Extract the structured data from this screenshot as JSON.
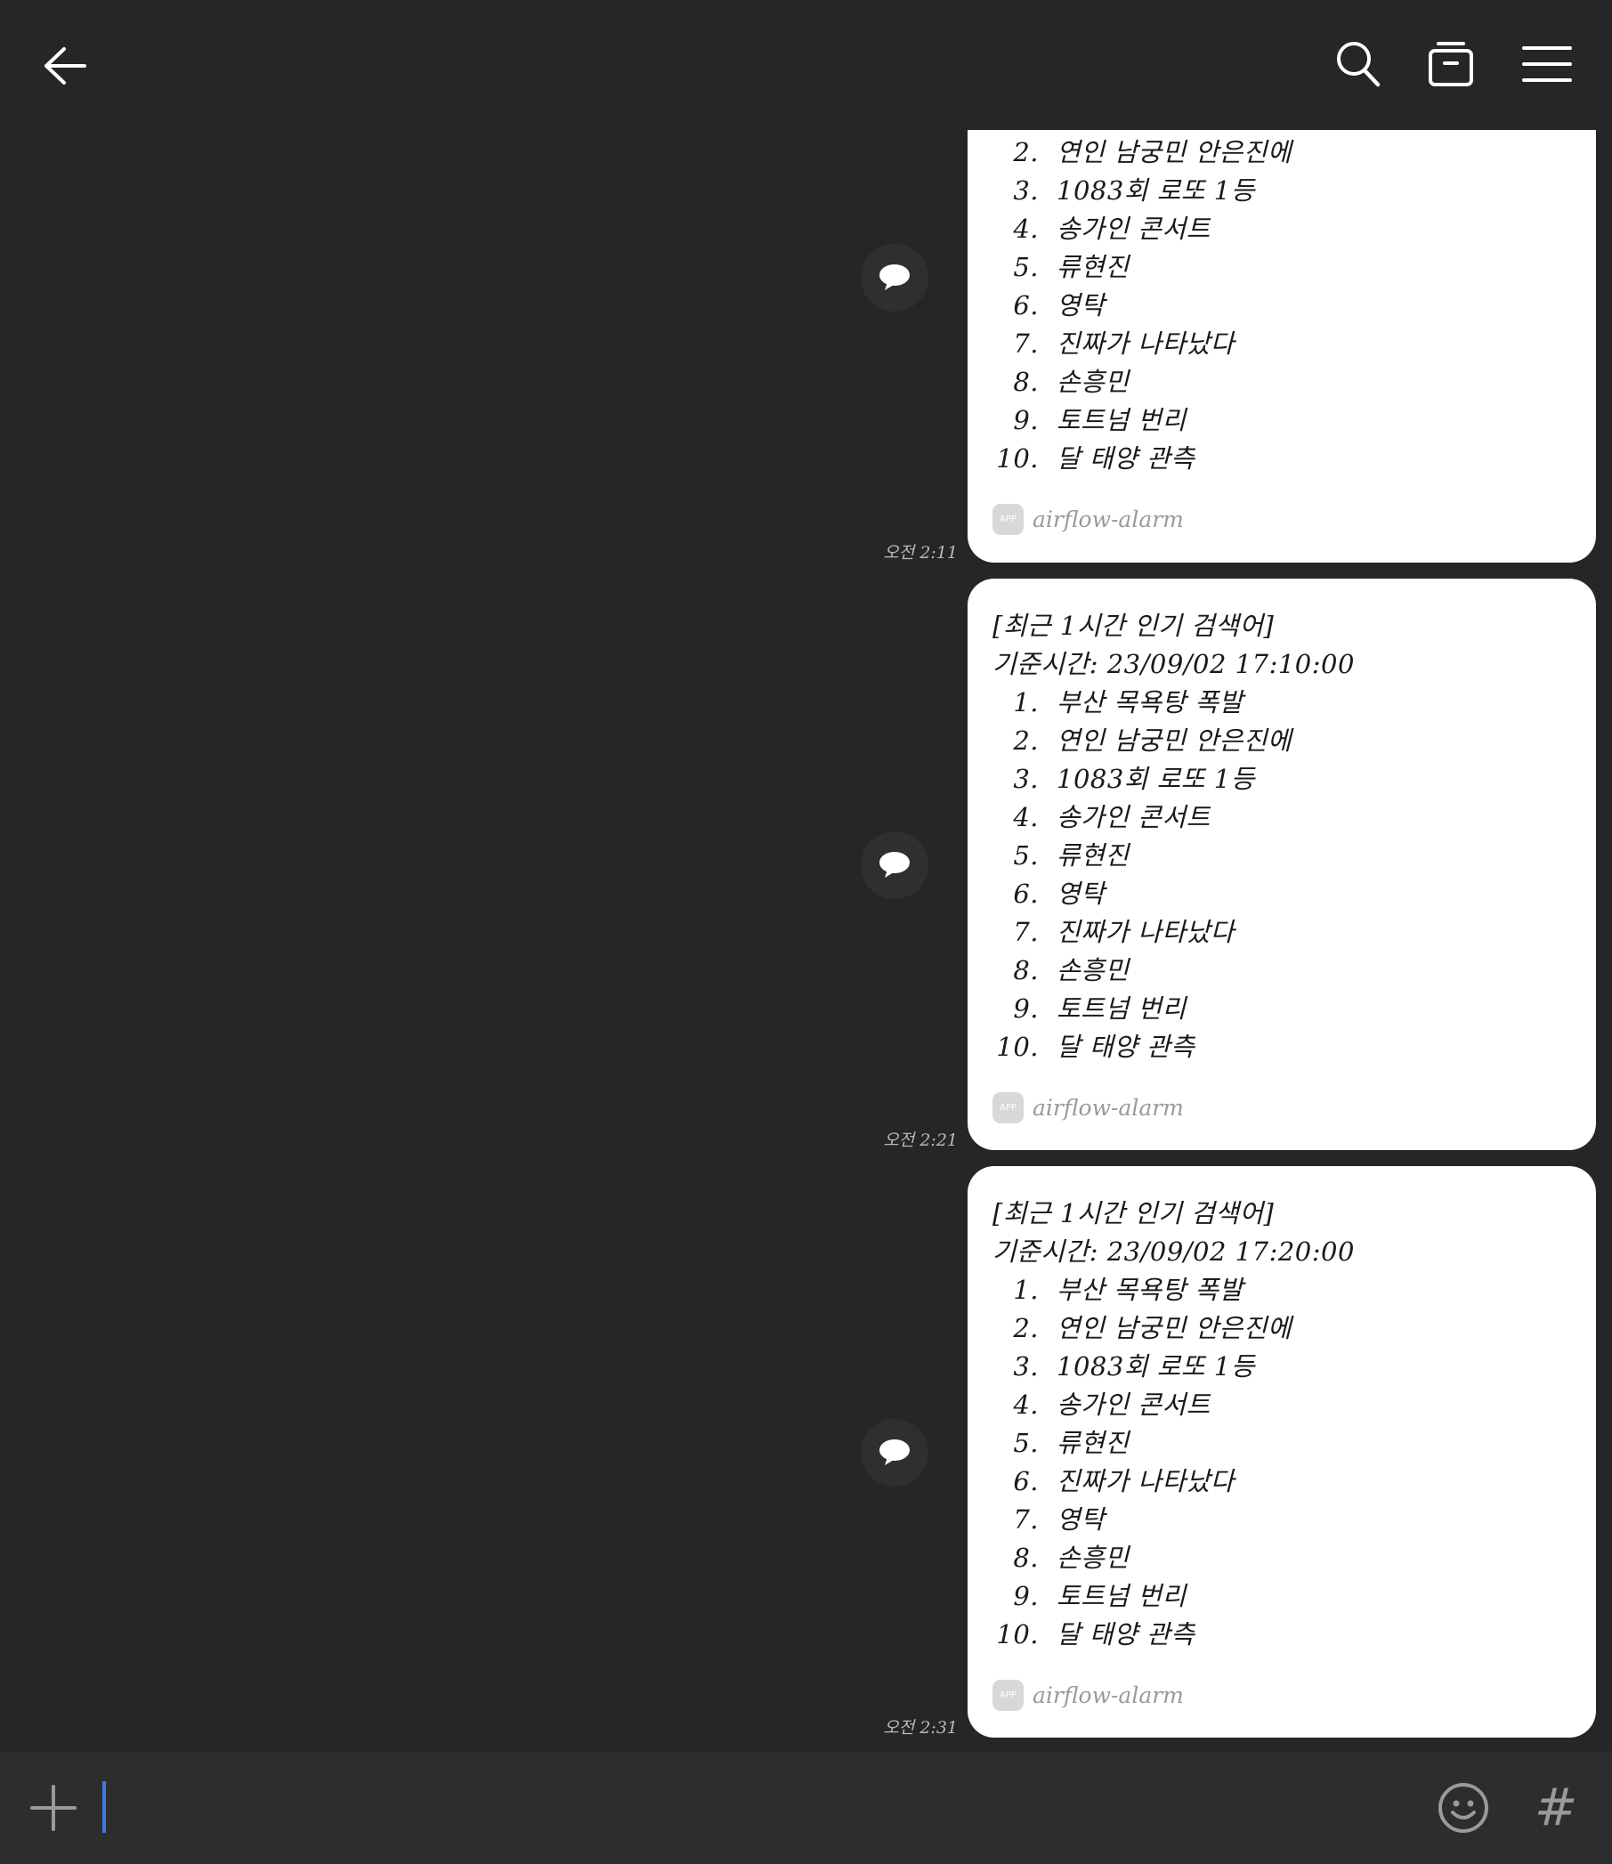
{
  "topbar": {
    "back_icon": "arrow-left-icon",
    "search_icon": "search-icon",
    "drawer_icon": "archive-box-icon",
    "menu_icon": "hamburger-menu-icon"
  },
  "messages": [
    {
      "header_lines": [],
      "items": [
        {
          "num": "2.",
          "text": "연인 남궁민 안은진에"
        },
        {
          "num": "3.",
          "text": "1083회 로또 1등"
        },
        {
          "num": "4.",
          "text": "송가인 콘서트"
        },
        {
          "num": "5.",
          "text": "류현진"
        },
        {
          "num": "6.",
          "text": "영탁"
        },
        {
          "num": "7.",
          "text": "진짜가 나타났다"
        },
        {
          "num": "8.",
          "text": "손흥민"
        },
        {
          "num": "9.",
          "text": "토트넘 번리"
        },
        {
          "num": "10.",
          "text": "달 태양 관측"
        }
      ],
      "app_badge": "APP",
      "app_name": "airflow-alarm",
      "time": "오전 2:11"
    },
    {
      "header_lines": [
        "[최근 1시간 인기 검색어]",
        "기준시간: 23/09/02 17:10:00"
      ],
      "items": [
        {
          "num": "1.",
          "text": "부산 목욕탕 폭발"
        },
        {
          "num": "2.",
          "text": "연인 남궁민 안은진에"
        },
        {
          "num": "3.",
          "text": "1083회 로또 1등"
        },
        {
          "num": "4.",
          "text": "송가인 콘서트"
        },
        {
          "num": "5.",
          "text": "류현진"
        },
        {
          "num": "6.",
          "text": "영탁"
        },
        {
          "num": "7.",
          "text": "진짜가 나타났다"
        },
        {
          "num": "8.",
          "text": "손흥민"
        },
        {
          "num": "9.",
          "text": "토트넘 번리"
        },
        {
          "num": "10.",
          "text": "달 태양 관측"
        }
      ],
      "app_badge": "APP",
      "app_name": "airflow-alarm",
      "time": "오전 2:21"
    },
    {
      "header_lines": [
        "[최근 1시간 인기 검색어]",
        "기준시간: 23/09/02 17:20:00"
      ],
      "items": [
        {
          "num": "1.",
          "text": "부산 목욕탕 폭발"
        },
        {
          "num": "2.",
          "text": "연인 남궁민 안은진에"
        },
        {
          "num": "3.",
          "text": "1083회 로또 1등"
        },
        {
          "num": "4.",
          "text": "송가인 콘서트"
        },
        {
          "num": "5.",
          "text": "류현진"
        },
        {
          "num": "6.",
          "text": "진짜가 나타났다"
        },
        {
          "num": "7.",
          "text": "영탁"
        },
        {
          "num": "8.",
          "text": "손흥민"
        },
        {
          "num": "9.",
          "text": "토트넘 번리"
        },
        {
          "num": "10.",
          "text": "달 태양 관측"
        }
      ],
      "app_badge": "APP",
      "app_name": "airflow-alarm",
      "time": "오전 2:31"
    }
  ],
  "composer": {
    "plus_icon": "plus-icon",
    "emoji_icon": "smiley-icon",
    "hashtag_icon": "hashtag-icon",
    "hashtag_glyph": "#",
    "input_value": ""
  },
  "colors": {
    "background": "#262626",
    "bubble": "#ffffff",
    "composer": "#2d2d2d",
    "cursor": "#3d7be6"
  }
}
